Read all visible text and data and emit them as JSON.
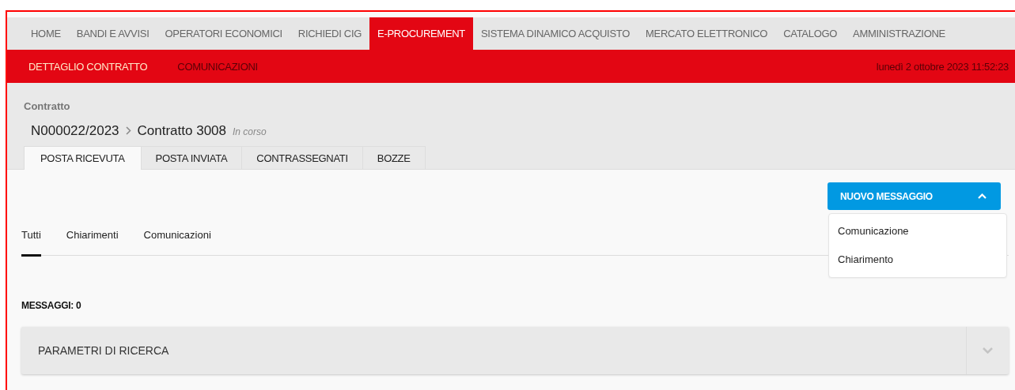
{
  "top_nav": [
    {
      "label": "HOME",
      "selected": false
    },
    {
      "label": "BANDI E AVVISI",
      "selected": false
    },
    {
      "label": "OPERATORI ECONOMICI",
      "selected": false
    },
    {
      "label": "RICHIEDI CIG",
      "selected": false
    },
    {
      "label": "E-PROCUREMENT",
      "selected": true
    },
    {
      "label": "SISTEMA DINAMICO ACQUISTO",
      "selected": false
    },
    {
      "label": "MERCATO ELETTRONICO",
      "selected": false
    },
    {
      "label": "CATALOGO",
      "selected": false
    },
    {
      "label": "AMMINISTRAZIONE",
      "selected": false
    }
  ],
  "sub_nav": [
    {
      "label": "DETTAGLIO CONTRATTO",
      "selected": false
    },
    {
      "label": "COMUNICAZIONI",
      "selected": true
    }
  ],
  "datetime": "lunedì 2 ottobre 2023 11:52:23",
  "header": {
    "caption": "Contratto",
    "code": "N000022/2023",
    "title": "Contratto 3008",
    "status": "In corso"
  },
  "mail_tabs": [
    {
      "label": "POSTA RICEVUTA",
      "selected": true
    },
    {
      "label": "POSTA INVIATA",
      "selected": false
    },
    {
      "label": "CONTRASSEGNATI",
      "selected": false
    },
    {
      "label": "BOZZE",
      "selected": false
    }
  ],
  "new_message": {
    "label": "NUOVO MESSAGGIO",
    "expanded": true,
    "options": [
      "Comunicazione",
      "Chiarimento"
    ]
  },
  "filter_tabs": [
    {
      "label": "Tutti",
      "selected": true
    },
    {
      "label": "Chiarimenti",
      "selected": false
    },
    {
      "label": "Comunicazioni",
      "selected": false
    }
  ],
  "count": "MESSAGGI: 0",
  "search_panel": {
    "title": "PARAMETRI DI RICERCA",
    "expanded": false
  }
}
